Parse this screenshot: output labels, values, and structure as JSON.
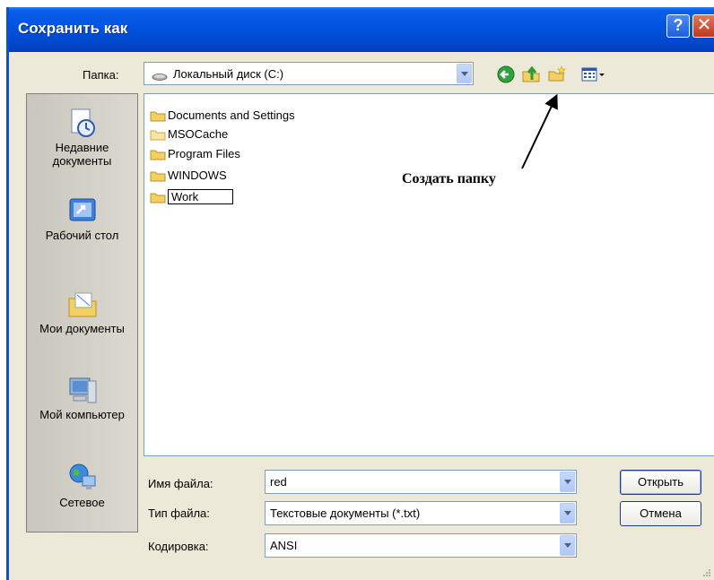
{
  "window": {
    "title": "Сохранить как",
    "help_label": "?",
    "close_label": "✕"
  },
  "toolbar": {
    "folder_label": "Папка:",
    "folder_value": "Локальный диск (C:)",
    "back_icon": "back-icon",
    "up_icon": "up-folder-icon",
    "new_folder_icon": "new-folder-icon",
    "views_icon": "views-menu-icon"
  },
  "places": [
    {
      "label": "Недавние документы",
      "icon": "recent-documents-icon"
    },
    {
      "label": "Рабочий стол",
      "icon": "desktop-icon"
    },
    {
      "label": "Мои документы",
      "icon": "my-documents-icon"
    },
    {
      "label": "Мой компьютер",
      "icon": "my-computer-icon"
    },
    {
      "label": "Сетевое",
      "icon": "network-icon"
    }
  ],
  "files": [
    {
      "name": "Documents and Settings"
    },
    {
      "name": "MSOCache"
    },
    {
      "name": "Program Files"
    },
    {
      "name": "WINDOWS"
    },
    {
      "name": "Work"
    }
  ],
  "annotation": "Создать папку",
  "form": {
    "filename_label": "Имя файла:",
    "filename_value": "red",
    "filetype_label": "Тип файла:",
    "filetype_value": "Текстовые документы (*.txt)",
    "encoding_label": "Кодировка:",
    "encoding_value": "ANSI"
  },
  "buttons": {
    "open": "Открыть",
    "cancel": "Отмена"
  }
}
